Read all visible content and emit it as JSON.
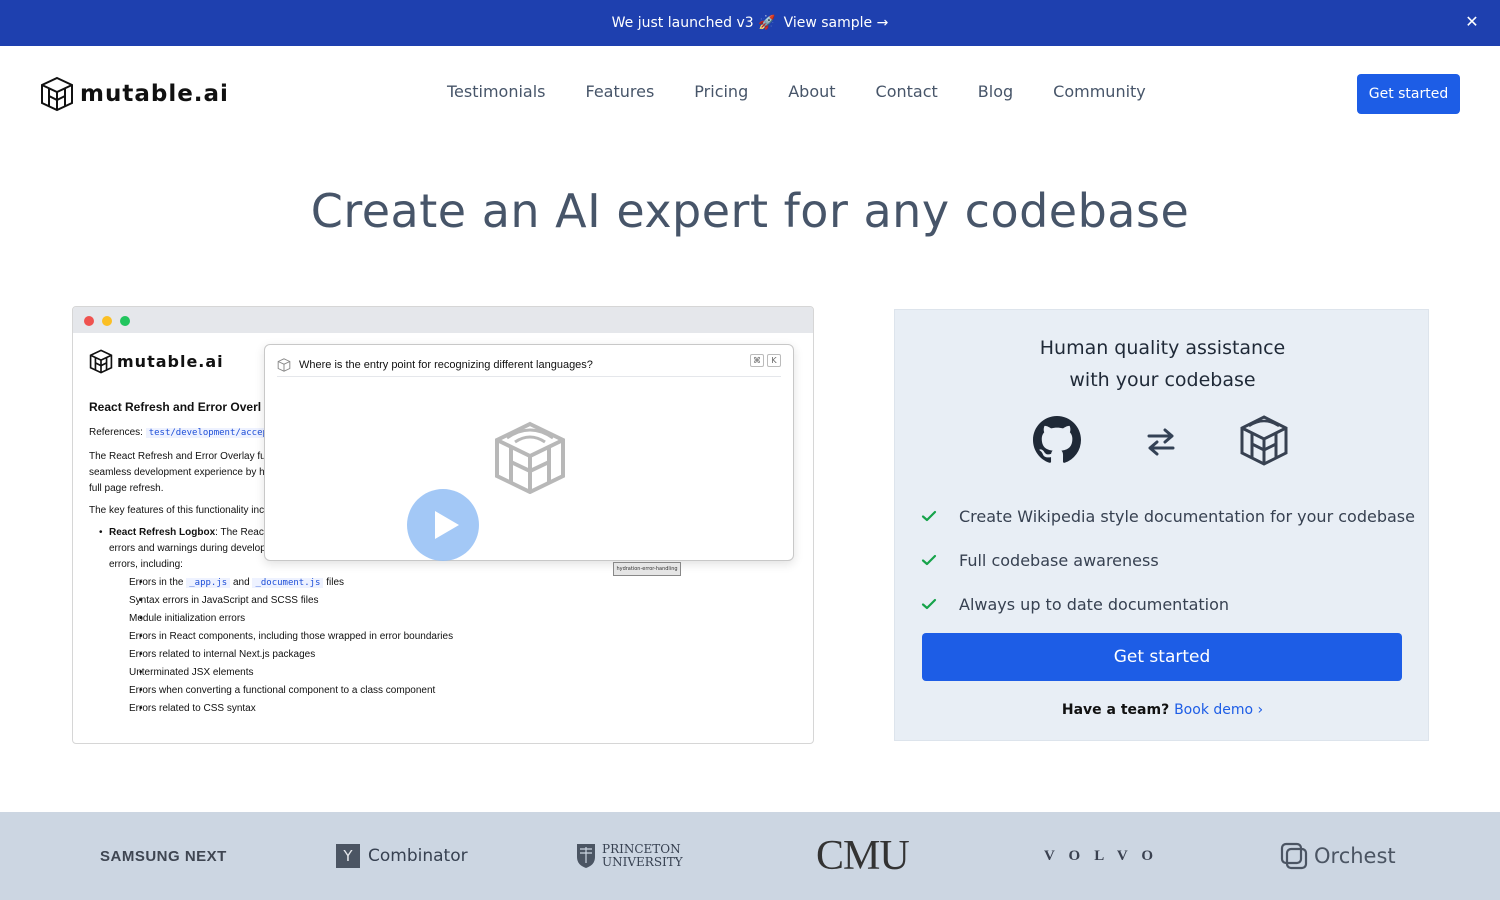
{
  "banner": {
    "text": "We just launched v3 🚀",
    "link": "View sample →",
    "close": "✕"
  },
  "nav": {
    "brand": "mutable.ai",
    "links": [
      "Testimonials",
      "Features",
      "Pricing",
      "About",
      "Contact",
      "Blog",
      "Community"
    ],
    "cta": "Get started"
  },
  "hero": {
    "title": "Create an AI expert for any codebase"
  },
  "demo": {
    "brand": "mutable.ai",
    "question": "Where is the entry point for recognizing different languages?",
    "keys": [
      "⌘",
      "K"
    ],
    "doc_title": "React Refresh and Error Overl",
    "refs_label": "References:",
    "refs_code": "test/development/accept",
    "para1_l1": "The React Refresh and Error Overlay fu",
    "para1_l2": "seamless development experience by ha",
    "para1_l3": "full page refresh.",
    "para2": "The key features of this functionality incl",
    "item1_title": "React Refresh Logbox",
    "item1_text": ": The React",
    "item1_l2": "errors and warnings during develop",
    "item1_l3": "errors, including:",
    "sub_a_pre": "Errors in the",
    "sub_a_code1": "_app.js",
    "sub_a_and": "and",
    "sub_a_code2": "_document.js",
    "sub_a_post": "files",
    "sub": [
      "Syntax errors in JavaScript and SCSS files",
      "Module initialization errors",
      "Errors in React components, including those wrapped in error boundaries",
      "Errors related to internal Next.js packages",
      "Unterminated JSX elements",
      "Errors when converting a functional component to a class component",
      "Errors related to CSS syntax"
    ],
    "tooltip": "hydration-error-handling"
  },
  "card": {
    "heading_l1": "Human quality assistance",
    "heading_l2": "with your codebase",
    "features": [
      "Create Wikipedia style documentation for your codebase",
      "Full codebase awareness",
      "Always up to date documentation"
    ],
    "cta": "Get started",
    "team_q": "Have a team?",
    "team_link": "Book demo ›"
  },
  "logos": {
    "samsung": "SAMSUNG NEXT",
    "yc_box": "Y",
    "yc": "Combinator",
    "princeton_l1": "PRINCETON",
    "princeton_l2": "UNIVERSITY",
    "cmu": "CMU",
    "volvo": "VOLVO",
    "orchest": "Orchest"
  },
  "colors": {
    "banner": "#1e40af",
    "primary": "#1d5de6",
    "check": "#16a34a"
  }
}
